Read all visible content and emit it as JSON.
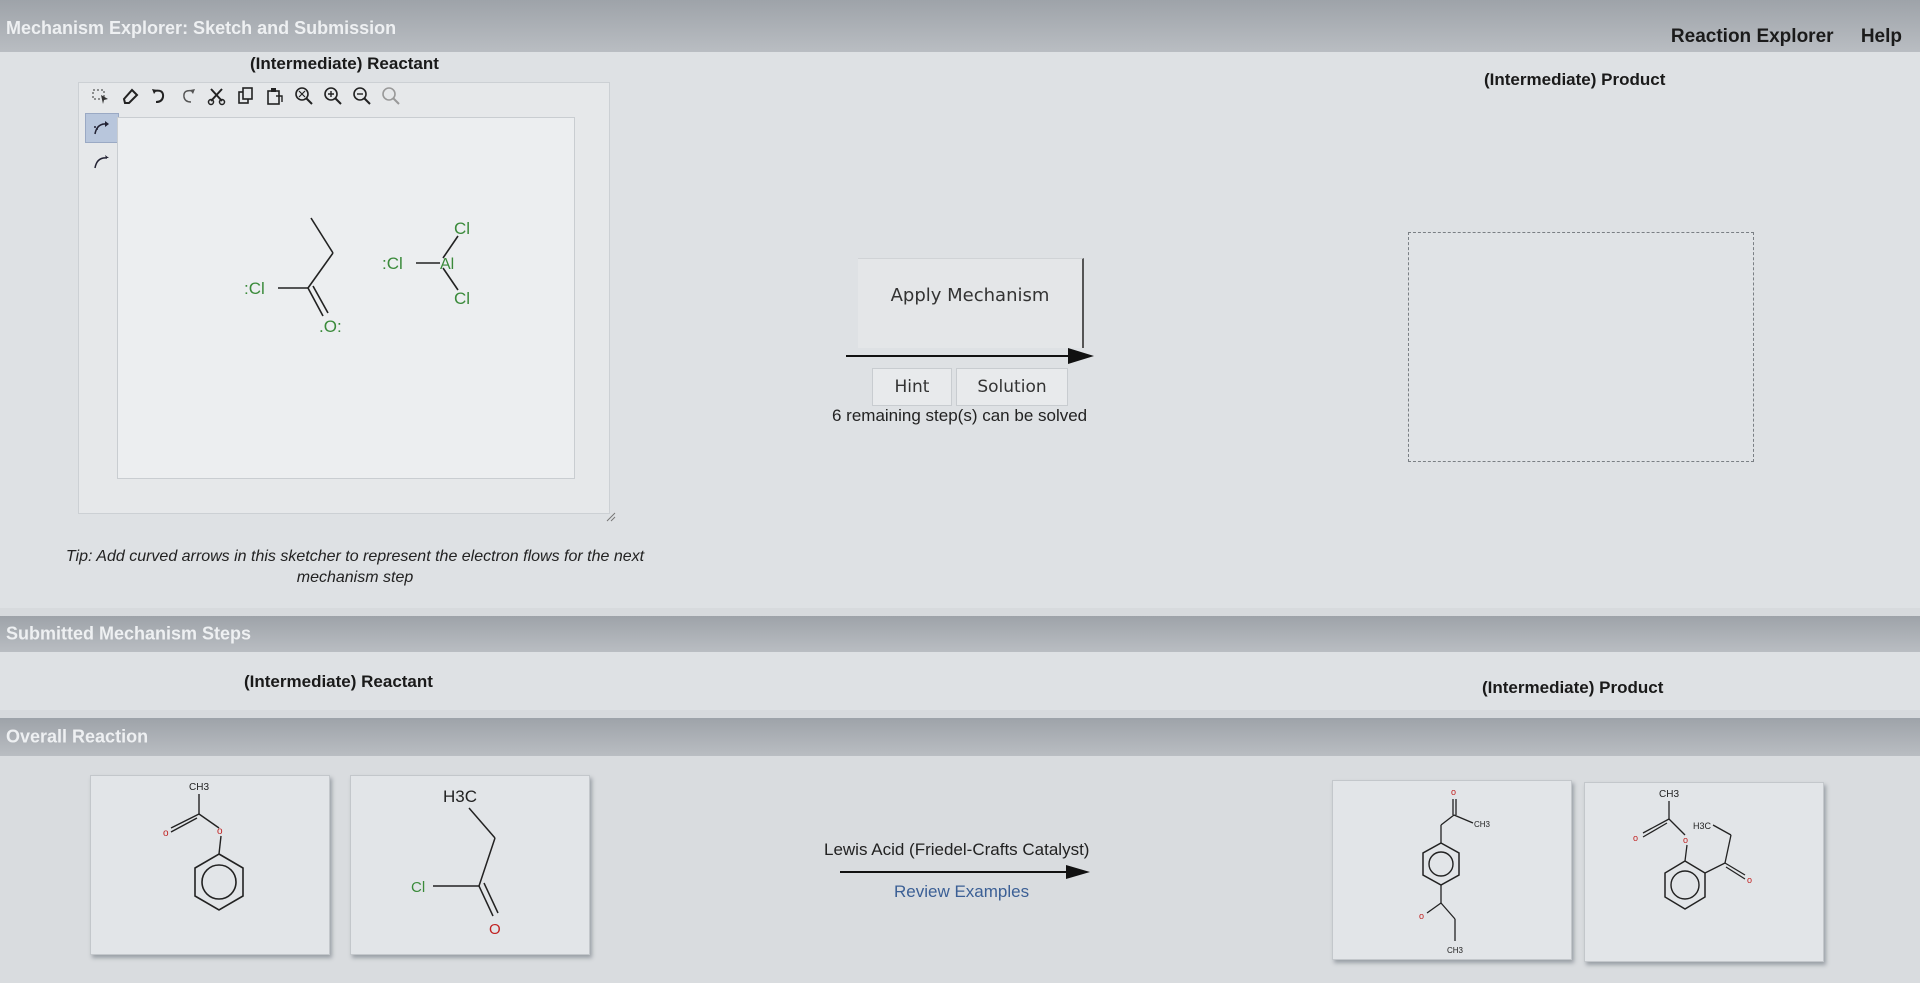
{
  "app": {
    "title": "Mechanism Explorer: Sketch and Submission",
    "links": [
      "Reaction Explorer",
      "Help"
    ]
  },
  "main": {
    "reactant_label": "(Intermediate) Reactant",
    "product_label": "(Intermediate) Product",
    "tip": "Tip: Add curved arrows in this sketcher to represent the electron flows for the next mechanism step",
    "apply_label": "Apply Mechanism",
    "hint_label": "Hint",
    "solution_label": "Solution",
    "remaining_text": "6 remaining step(s) can be solved",
    "toolbar_icons": [
      "selection-icon",
      "eraser-icon",
      "undo-icon",
      "redo-icon",
      "cut-icon",
      "copy-icon",
      "paste-icon",
      "zoom-reset-icon",
      "zoom-in-icon",
      "zoom-out-icon",
      "zoom-fit-icon"
    ],
    "side_tools": [
      "curved-arrow-two-electron-icon",
      "curved-arrow-one-electron-icon"
    ],
    "canvas_atoms": {
      "cl_left": ":Cl",
      "o": ".O:",
      "cl_mid": ":Cl",
      "al": "Al",
      "cl_top": "Cl",
      "cl_bottom": "Cl"
    }
  },
  "submitted": {
    "title": "Submitted Mechanism Steps",
    "reactant_label": "(Intermediate) Reactant",
    "product_label": "(Intermediate) Product"
  },
  "overall": {
    "title": "Overall Reaction",
    "condition": "Lewis Acid (Friedel-Crafts Catalyst)",
    "review_link": "Review Examples",
    "mol_labels": {
      "m1_ch3": "CH3",
      "m1_o1": "o",
      "m1_o2": "o",
      "m2_h3c": "H3C",
      "m2_cl": "Cl",
      "m2_o": "O",
      "p1_o_top": "o",
      "p1_ch3_top": "CH3",
      "p1_o_bottom": "o",
      "p1_ch3_bottom": "CH3",
      "p2_ch3": "CH3",
      "p2_h3c": "H3C",
      "p2_o1": "o",
      "p2_o2": "o",
      "p2_o3": "o"
    }
  },
  "colors": {
    "chlorine": "#3a8a3a",
    "oxygen": "#c02020",
    "bond": "#2a2a2a",
    "link": "#3b5f95"
  }
}
